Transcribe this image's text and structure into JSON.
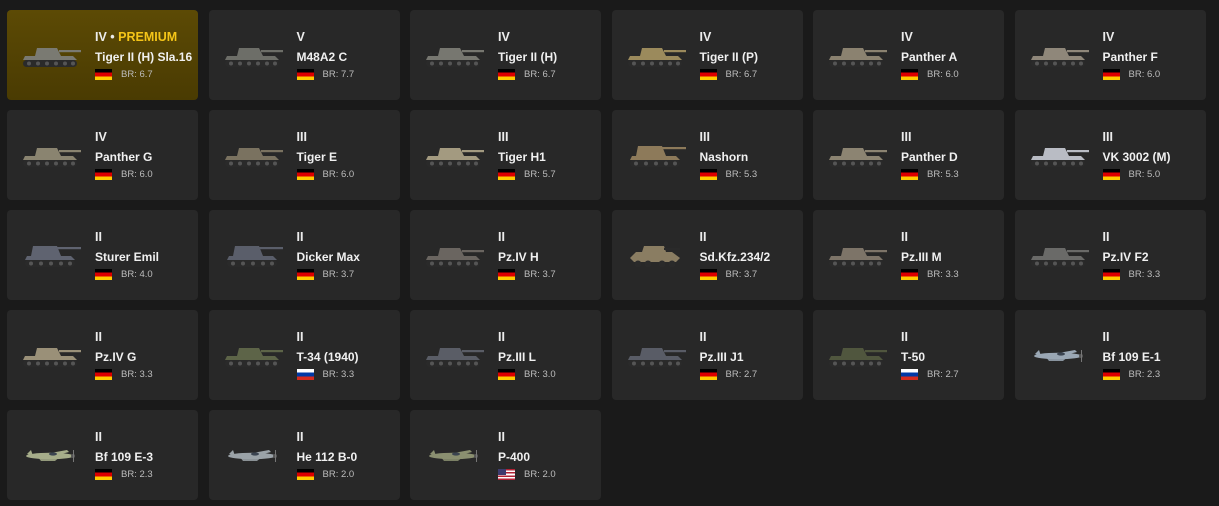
{
  "colors": {
    "background": "#1a1a1a",
    "card": "#282828",
    "premium_card": "#5c4a05",
    "premium_text": "#f5c518"
  },
  "vehicles": [
    {
      "tier": "IV",
      "premium_label": "PREMIUM",
      "name": "Tiger II (H) Sla.16",
      "nation": "de",
      "flag_icon": "germany-flag-icon",
      "br": "BR: 6.7",
      "kind": "tank",
      "hull": "#7a7a72",
      "premium": true
    },
    {
      "tier": "V",
      "premium_label": "",
      "name": "M48A2 C",
      "nation": "de",
      "flag_icon": "germany-flag-icon",
      "br": "BR: 7.7",
      "kind": "tank",
      "hull": "#6d6e68"
    },
    {
      "tier": "IV",
      "premium_label": "",
      "name": "Tiger II (H)",
      "nation": "de",
      "flag_icon": "germany-flag-icon",
      "br": "BR: 6.7",
      "kind": "tank",
      "hull": "#777770"
    },
    {
      "tier": "IV",
      "premium_label": "",
      "name": "Tiger II (P)",
      "nation": "de",
      "flag_icon": "germany-flag-icon",
      "br": "BR: 6.7",
      "kind": "tank",
      "hull": "#9b8a5c"
    },
    {
      "tier": "IV",
      "premium_label": "",
      "name": "Panther A",
      "nation": "de",
      "flag_icon": "germany-flag-icon",
      "br": "BR: 6.0",
      "kind": "tank",
      "hull": "#8b8270"
    },
    {
      "tier": "IV",
      "premium_label": "",
      "name": "Panther F",
      "nation": "de",
      "flag_icon": "germany-flag-icon",
      "br": "BR: 6.0",
      "kind": "tank",
      "hull": "#8f877a"
    },
    {
      "tier": "IV",
      "premium_label": "",
      "name": "Panther G",
      "nation": "de",
      "flag_icon": "germany-flag-icon",
      "br": "BR: 6.0",
      "kind": "tank",
      "hull": "#8a8470"
    },
    {
      "tier": "III",
      "premium_label": "",
      "name": "Tiger E",
      "nation": "de",
      "flag_icon": "germany-flag-icon",
      "br": "BR: 6.0",
      "kind": "tank",
      "hull": "#7a7260"
    },
    {
      "tier": "III",
      "premium_label": "",
      "name": "Tiger H1",
      "nation": "de",
      "flag_icon": "germany-flag-icon",
      "br": "BR: 5.7",
      "kind": "tank",
      "hull": "#a39a80"
    },
    {
      "tier": "III",
      "premium_label": "",
      "name": "Nashorn",
      "nation": "de",
      "flag_icon": "germany-flag-icon",
      "br": "BR: 5.3",
      "kind": "spg",
      "hull": "#8d7a5a"
    },
    {
      "tier": "III",
      "premium_label": "",
      "name": "Panther D",
      "nation": "de",
      "flag_icon": "germany-flag-icon",
      "br": "BR: 5.3",
      "kind": "tank",
      "hull": "#8c8472"
    },
    {
      "tier": "III",
      "premium_label": "",
      "name": "VK 3002 (M)",
      "nation": "de",
      "flag_icon": "germany-flag-icon",
      "br": "BR: 5.0",
      "kind": "tank",
      "hull": "#b9bcc4"
    },
    {
      "tier": "II",
      "premium_label": "",
      "name": "Sturer Emil",
      "nation": "de",
      "flag_icon": "germany-flag-icon",
      "br": "BR: 4.0",
      "kind": "spg",
      "hull": "#5f6370"
    },
    {
      "tier": "II",
      "premium_label": "",
      "name": "Dicker Max",
      "nation": "de",
      "flag_icon": "germany-flag-icon",
      "br": "BR: 3.7",
      "kind": "spg",
      "hull": "#5a5e6a"
    },
    {
      "tier": "II",
      "premium_label": "",
      "name": "Pz.IV H",
      "nation": "de",
      "flag_icon": "germany-flag-icon",
      "br": "BR: 3.7",
      "kind": "tank",
      "hull": "#6a6560"
    },
    {
      "tier": "II",
      "premium_label": "",
      "name": "Sd.Kfz.234/2",
      "nation": "de",
      "flag_icon": "germany-flag-icon",
      "br": "BR: 3.7",
      "kind": "armored-car",
      "hull": "#8a7d62"
    },
    {
      "tier": "II",
      "premium_label": "",
      "name": "Pz.III M",
      "nation": "de",
      "flag_icon": "germany-flag-icon",
      "br": "BR: 3.3",
      "kind": "tank",
      "hull": "#7d7468"
    },
    {
      "tier": "II",
      "premium_label": "",
      "name": "Pz.IV F2",
      "nation": "de",
      "flag_icon": "germany-flag-icon",
      "br": "BR: 3.3",
      "kind": "tank",
      "hull": "#6a6a68"
    },
    {
      "tier": "II",
      "premium_label": "",
      "name": "Pz.IV G",
      "nation": "de",
      "flag_icon": "germany-flag-icon",
      "br": "BR: 3.3",
      "kind": "tank",
      "hull": "#9a9078"
    },
    {
      "tier": "II",
      "premium_label": "",
      "name": "T-34 (1940)",
      "nation": "ru",
      "flag_icon": "russia-flag-icon",
      "br": "BR: 3.3",
      "kind": "tank",
      "hull": "#5d6448"
    },
    {
      "tier": "II",
      "premium_label": "",
      "name": "Pz.III L",
      "nation": "de",
      "flag_icon": "germany-flag-icon",
      "br": "BR: 3.0",
      "kind": "tank",
      "hull": "#5a5d66"
    },
    {
      "tier": "II",
      "premium_label": "",
      "name": "Pz.III J1",
      "nation": "de",
      "flag_icon": "germany-flag-icon",
      "br": "BR: 2.7",
      "kind": "tank",
      "hull": "#595c66"
    },
    {
      "tier": "II",
      "premium_label": "",
      "name": "T-50",
      "nation": "ru",
      "flag_icon": "russia-flag-icon",
      "br": "BR: 2.7",
      "kind": "tank",
      "hull": "#50563e"
    },
    {
      "tier": "II",
      "premium_label": "",
      "name": "Bf 109 E-1",
      "nation": "de",
      "flag_icon": "germany-flag-icon",
      "br": "BR: 2.3",
      "kind": "plane",
      "hull": "#9aa7b4"
    },
    {
      "tier": "II",
      "premium_label": "",
      "name": "Bf 109 E-3",
      "nation": "de",
      "flag_icon": "germany-flag-icon",
      "br": "BR: 2.3",
      "kind": "plane",
      "hull": "#a6ad8a"
    },
    {
      "tier": "II",
      "premium_label": "",
      "name": "He 112 B-0",
      "nation": "de",
      "flag_icon": "germany-flag-icon",
      "br": "BR: 2.0",
      "kind": "plane",
      "hull": "#9ba3a8"
    },
    {
      "tier": "II",
      "premium_label": "",
      "name": "P-400",
      "nation": "us",
      "flag_icon": "usa-flag-icon",
      "br": "BR: 2.0",
      "kind": "plane",
      "hull": "#8a8f70"
    }
  ]
}
